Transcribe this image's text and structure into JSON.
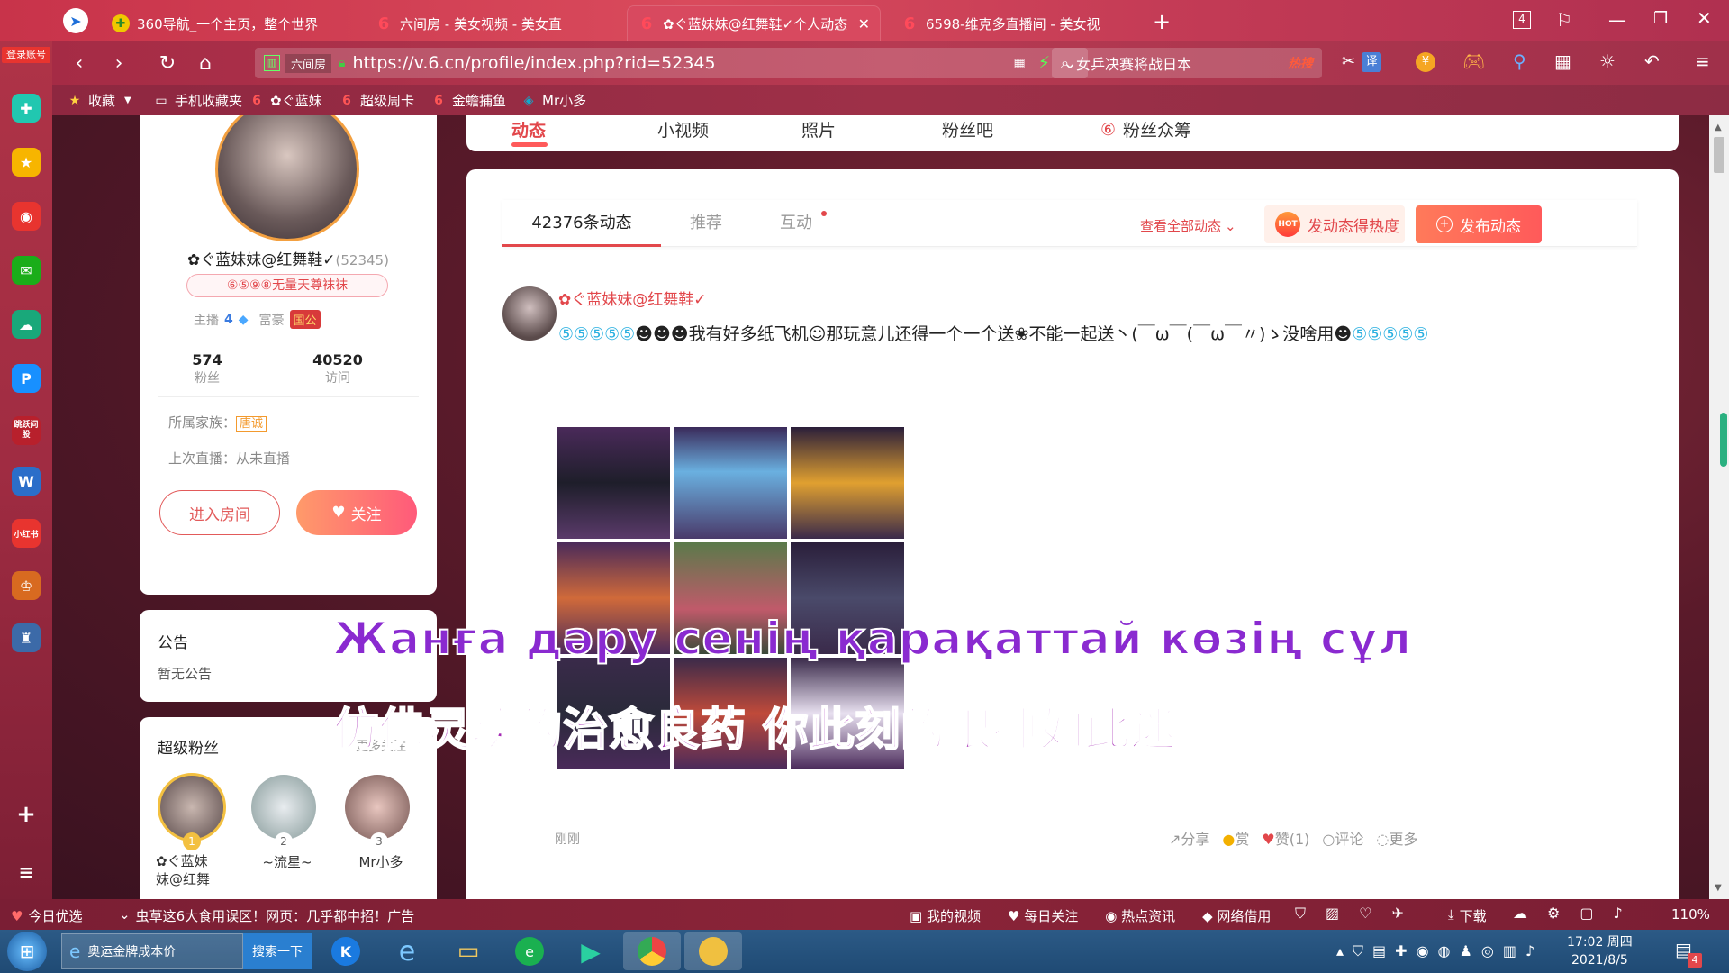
{
  "tabs": [
    {
      "label": "360导航_一个主页，整个世界",
      "icon": "360-plus-icon"
    },
    {
      "label": "六间房 - 美女视频 - 美女直",
      "icon": "six-logo-icon"
    },
    {
      "label": "✿ぐ蓝妹妹@红舞鞋✓个人动态",
      "icon": "six-logo-icon",
      "active": true
    },
    {
      "label": "6598-维克多直播间 - 美女视",
      "icon": "six-logo-icon"
    }
  ],
  "window": {
    "tab_count": "4"
  },
  "address": {
    "url": "https://v.6.cn/profile/index.php?rid=52345",
    "prefix": "六间房",
    "search_placeholder": "女乒决赛将战日本",
    "hot_badge": "热搜",
    "translate": "译"
  },
  "bookmarks": [
    {
      "label": "收藏"
    },
    {
      "label": "手机收藏夹"
    },
    {
      "label": "✿ぐ蓝妹"
    },
    {
      "label": "超级周卡"
    },
    {
      "label": "金蟾捕鱼"
    },
    {
      "label": "Mr小多"
    }
  ],
  "sidebar": {
    "login": "登录账号",
    "app_labels": [
      "跳跃问股",
      "小红书"
    ]
  },
  "profile": {
    "name": "✿ぐ蓝妹妹@红舞鞋✓",
    "rid": "(52345)",
    "title_badge": "⑥⑤⑨⑧无量天尊袜袜",
    "anchor_label": "主播",
    "anchor_level": "4",
    "rich_label": "富豪",
    "rich_badge": "国公",
    "fans_count": "574",
    "fans_label": "粉丝",
    "visits_count": "40520",
    "visits_label": "访问",
    "family_label": "所属家族：",
    "family_value": "唐诚",
    "last_live": "上次直播：从未直播",
    "enter_room": "进入房间",
    "follow": "关注"
  },
  "notice": {
    "title": "公告",
    "content": "暂无公告"
  },
  "superfans": {
    "title": "超级粉丝",
    "more": "更多关注",
    "fans": [
      {
        "rank": "1",
        "name": "✿ぐ蓝妹\n妹@红舞"
      },
      {
        "rank": "2",
        "name": "~流星~"
      },
      {
        "rank": "3",
        "name": "Mr小多"
      }
    ]
  },
  "nav_tabs": [
    "动态",
    "小视频",
    "照片",
    "粉丝吧",
    "粉丝众筹"
  ],
  "feed": {
    "tabs": [
      "42376条动态",
      "推荐",
      "互动"
    ],
    "view_all": "查看全部动态",
    "hot_button": "发动态得热度",
    "hot_badge": "HOT",
    "publish_button": "发布动态",
    "post": {
      "author": "✿ぐ蓝妹妹@红舞鞋✓",
      "text": "我有好多纸飞机",
      "text2": "那玩意儿还得一个一个送",
      "text3": "不能一起送丶(￣ω￣(￣ω￣〃)ゝ没啥用",
      "time": "刚刚",
      "actions": [
        "分享",
        "赏",
        "赞(1)",
        "评论",
        "更多"
      ]
    }
  },
  "subtitles": {
    "line1": "Жанға дәру сенің қарақаттай көзің сұл",
    "line2": "仿佛灵魂的治愈良药  你此刻的眼神如此迷"
  },
  "status": {
    "left": "今日优选",
    "news": "虫草这6大食用误区！网页：几乎都中招！广告",
    "items": [
      "我的视频",
      "每日关注",
      "热点资讯",
      "网络借用",
      "下载"
    ],
    "zoom": "110%"
  },
  "taskbar": {
    "app_label": "奥运金牌成本价",
    "search": "搜索一下",
    "time": "17:02 周四",
    "date": "2021/8/5",
    "notif": "4"
  }
}
